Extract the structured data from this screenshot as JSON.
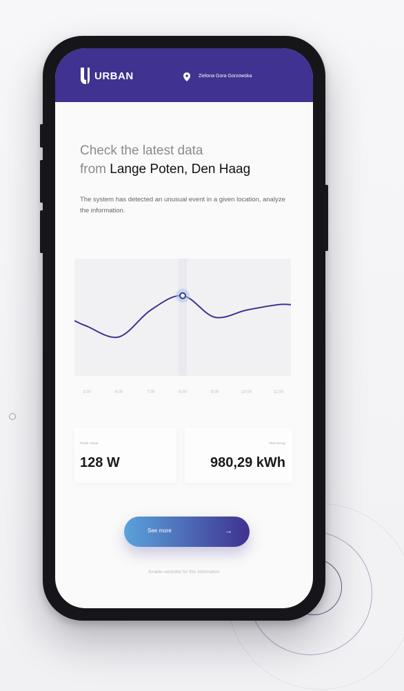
{
  "header": {
    "brand": "URBAN",
    "location": "Zielona Gora Gorzowska",
    "bg_color": "#3f3290",
    "icons": [
      "urban-logo-icon",
      "location-pin-icon"
    ]
  },
  "headline": {
    "prefix_line1": "Check the latest data",
    "prefix_line2": "from",
    "place": "Lange Poten, Den Haag"
  },
  "description": "The system has detected an unusual event in a given location, analyze the information.",
  "chart_data": {
    "type": "line",
    "x": [
      "3:00",
      "4:00",
      "7:00",
      "8:00",
      "9:00",
      "10:00",
      "11:00"
    ],
    "series": [
      {
        "values": [
          4,
          2.8,
          5.8,
          7.4,
          5.0,
          5.8,
          6.4
        ]
      }
    ],
    "highlight": {
      "x": "8:00"
    },
    "ylim": [
      0,
      10
    ],
    "grid": false,
    "line_color": "#3f3290"
  },
  "stats": {
    "left": {
      "label": "Power output",
      "value": "128 W"
    },
    "right": {
      "label": "Total energy",
      "value": "980,29 kWh"
    }
  },
  "actions": {
    "see_more_label": "See more",
    "reminder": "Enable reminder for this information"
  },
  "colors": {
    "accent": "#3f3290",
    "button_gradient_start": "#5aa3dc",
    "button_gradient_end": "#3f3290"
  }
}
